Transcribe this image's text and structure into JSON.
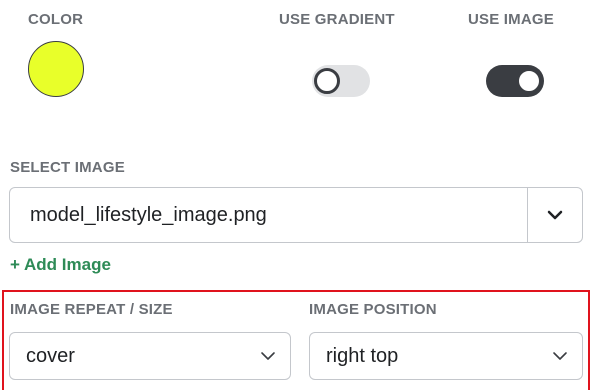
{
  "color": {
    "label": "COLOR",
    "value": "#e8ff2a"
  },
  "gradient": {
    "label": "USE GRADIENT",
    "enabled": false
  },
  "image_toggle": {
    "label": "USE IMAGE",
    "enabled": true
  },
  "select_image": {
    "label": "SELECT IMAGE",
    "value": "model_lifestyle_image.png",
    "chevron_icon": "chevron-down-icon"
  },
  "add_image": {
    "label": "+ Add Image",
    "color": "#2e8b57"
  },
  "repeat_size": {
    "label": "IMAGE REPEAT / SIZE",
    "value": "cover"
  },
  "position": {
    "label": "IMAGE POSITION",
    "value": "right top"
  },
  "highlight_color": "#e0131d"
}
